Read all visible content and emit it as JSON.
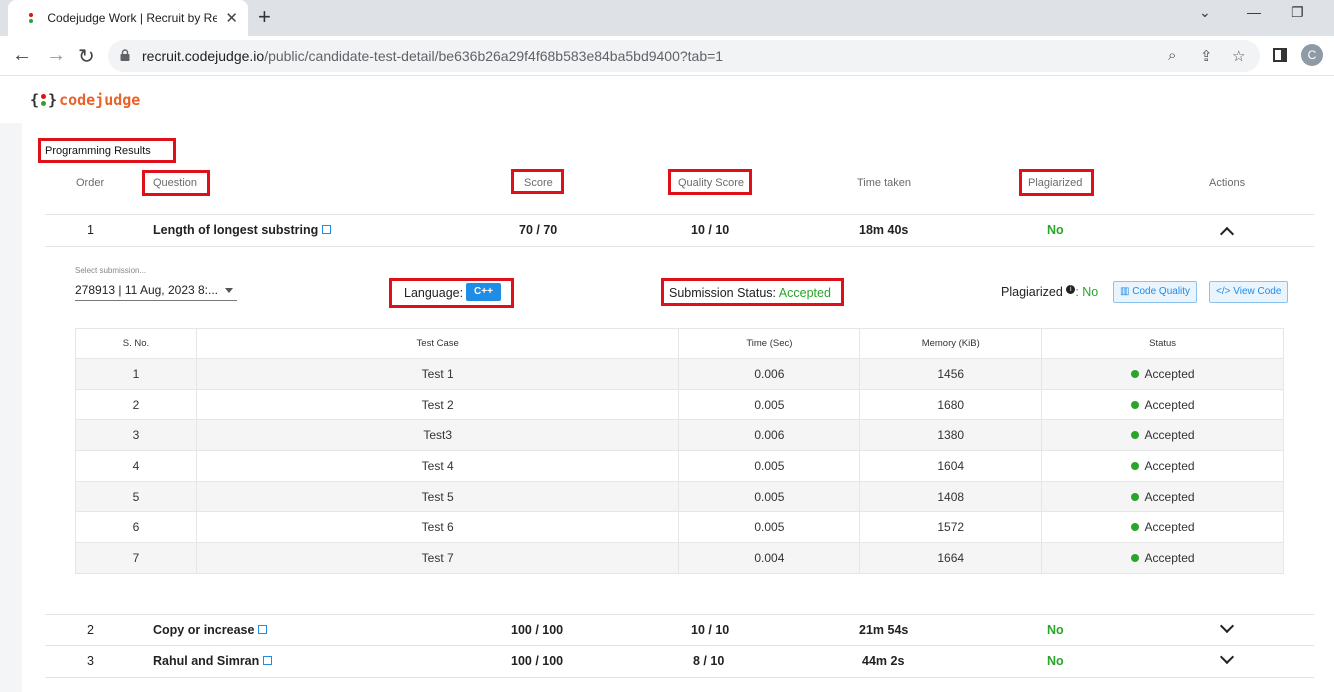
{
  "browser": {
    "tab_title": "Codejudge Work | Recruit by Rea",
    "url_host": "recruit.codejudge.io",
    "url_path": "/public/candidate-test-detail/be636b26a29f4f68b583e84ba5bd9400?tab=1",
    "profile_initial": "C"
  },
  "brand": {
    "open_brace": "{",
    "close_brace": "}",
    "word": "codejudge"
  },
  "section_title": "Programming Results",
  "columns": {
    "order": "Order",
    "question": "Question",
    "score": "Score",
    "quality": "Quality Score",
    "time": "Time taken",
    "plagiarized": "Plagiarized",
    "actions": "Actions"
  },
  "questions": [
    {
      "order": "1",
      "name": "Length of longest substring",
      "score": "70 / 70",
      "quality": "10 / 10",
      "time": "18m 40s",
      "plagiarized": "No"
    },
    {
      "order": "2",
      "name": "Copy or increase",
      "score": "100 / 100",
      "quality": "10 / 10",
      "time": "21m 54s",
      "plagiarized": "No"
    },
    {
      "order": "3",
      "name": "Rahul and Simran",
      "score": "100 / 100",
      "quality": "8 / 10",
      "time": "44m 2s",
      "plagiarized": "No"
    }
  ],
  "detail": {
    "select_label": "Select submission...",
    "select_value": "278913 | 11 Aug, 2023 8:...",
    "language_label": "Language:",
    "language": "C++",
    "status_label": "Submission Status:",
    "status": "Accepted",
    "plag_label": "Plagiarized",
    "plag_value": ": No",
    "code_quality_btn": "Code Quality",
    "view_code_btn": "View Code"
  },
  "testcase_headers": [
    "S. No.",
    "Test Case",
    "Time (Sec)",
    "Memory (KiB)",
    "Status"
  ],
  "testcases": [
    {
      "no": "1",
      "name": "Test 1",
      "time": "0.006",
      "memory": "1456",
      "status": "Accepted"
    },
    {
      "no": "2",
      "name": "Test 2",
      "time": "0.005",
      "memory": "1680",
      "status": "Accepted"
    },
    {
      "no": "3",
      "name": "Test3",
      "time": "0.006",
      "memory": "1380",
      "status": "Accepted"
    },
    {
      "no": "4",
      "name": "Test 4",
      "time": "0.005",
      "memory": "1604",
      "status": "Accepted"
    },
    {
      "no": "5",
      "name": "Test 5",
      "time": "0.005",
      "memory": "1408",
      "status": "Accepted"
    },
    {
      "no": "6",
      "name": "Test 6",
      "time": "0.005",
      "memory": "1572",
      "status": "Accepted"
    },
    {
      "no": "7",
      "name": "Test 7",
      "time": "0.004",
      "memory": "1664",
      "status": "Accepted"
    }
  ],
  "colors": {
    "accent": "#1f8ce6",
    "success": "#2aa52a",
    "brand": "#e8622a",
    "highlight": "#e0101a"
  }
}
